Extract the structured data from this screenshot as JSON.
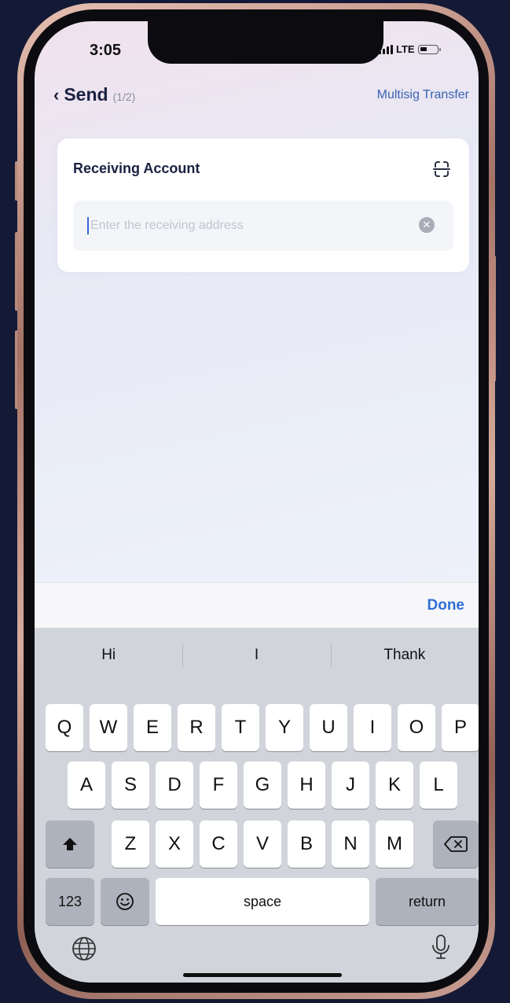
{
  "status_bar": {
    "time": "3:05",
    "network": "LTE"
  },
  "nav": {
    "back_title": "Send",
    "step": "(1/2)",
    "multisig_label": "Multisig Transfer"
  },
  "card": {
    "title": "Receiving Account",
    "input_placeholder": "Enter the receiving address",
    "input_value": ""
  },
  "keyboard": {
    "done_label": "Done",
    "suggestions": [
      "Hi",
      "I",
      "Thank"
    ],
    "row1": [
      "Q",
      "W",
      "E",
      "R",
      "T",
      "Y",
      "U",
      "I",
      "O",
      "P"
    ],
    "row2": [
      "A",
      "S",
      "D",
      "F",
      "G",
      "H",
      "J",
      "K",
      "L"
    ],
    "row3": [
      "Z",
      "X",
      "C",
      "V",
      "B",
      "N",
      "M"
    ],
    "numbers_label": "123",
    "space_label": "space",
    "return_label": "return"
  },
  "icons": {
    "back": "chevron-left-icon",
    "scan": "scan-icon",
    "clear": "clear-icon",
    "shift": "shift-icon",
    "delete": "backspace-icon",
    "emoji": "emoji-icon",
    "globe": "globe-icon",
    "mic": "microphone-icon"
  },
  "colors": {
    "accent": "#2f6fd6",
    "link": "#3a63b0",
    "title": "#1b2140"
  }
}
